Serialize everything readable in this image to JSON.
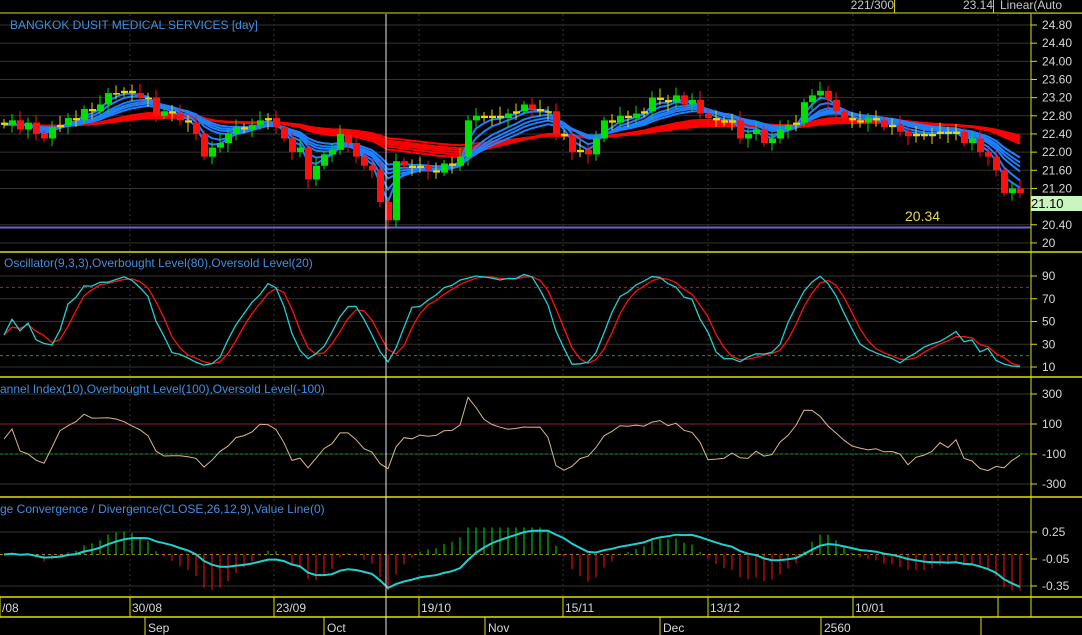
{
  "topbar": {
    "count": "221/300",
    "price": "23.14",
    "scale_mode": "Linear(Auto"
  },
  "price_panel": {
    "title": "BANGKOK DUSIT MEDICAL SERVICES [day]",
    "ticks": [
      "24.80",
      "24.40",
      "24.00",
      "23.60",
      "23.20",
      "22.80",
      "22.40",
      "22.00",
      "21.60",
      "21.20",
      "20.40",
      "20"
    ],
    "last_price_label": "21.10",
    "hline_value": 20.34,
    "hline_label": "20.34"
  },
  "stoch_panel": {
    "title": "Oscillator(9,3,3),Overbought Level(80),Oversold Level(20)",
    "ticks": [
      "90",
      "70",
      "50",
      "30",
      "10"
    ],
    "overbought": 80,
    "oversold": 20
  },
  "cci_panel": {
    "title": "annel Index(10),Overbought Level(100),Oversold Level(-100)",
    "ticks": [
      "300",
      "100",
      "-100",
      "-300"
    ],
    "overbought": 100,
    "oversold": -100
  },
  "macd_panel": {
    "title": "ge Convergence / Divergence(CLOSE,26,12,9),Value Line(0)",
    "ticks": [
      "0.25",
      "-0.05",
      "-0.35"
    ],
    "value_line": 0
  },
  "date_axis": {
    "labels": [
      "/08",
      "30/08",
      "23/09",
      "19/10",
      "15/11",
      "13/12",
      "10/01"
    ]
  },
  "month_axis": {
    "labels": [
      "Sep",
      "Oct",
      "Nov",
      "Dec",
      "2560"
    ]
  },
  "colors": {
    "up": "#00e000",
    "down": "#ff1010",
    "doji": "#e8d800",
    "ma_short": "#1e7fff",
    "ma_long": "#ff0000",
    "k_line": "#20d0d0",
    "d_line": "#ff1010",
    "cci_line": "#d8b888",
    "axis": "#e0e000"
  },
  "chart_data": {
    "type": "candlestick",
    "title": "BANGKOK DUSIT MEDICAL SERVICES [day]",
    "ylim": [
      20,
      24.8
    ],
    "close": [
      22.6,
      22.7,
      22.5,
      22.65,
      22.4,
      22.3,
      22.55,
      22.6,
      22.75,
      22.7,
      22.95,
      22.9,
      23.05,
      23.3,
      23.3,
      23.35,
      23.3,
      23.2,
      23.2,
      22.8,
      22.9,
      22.85,
      22.7,
      22.65,
      22.4,
      21.9,
      22.1,
      22.2,
      22.4,
      22.55,
      22.5,
      22.6,
      22.7,
      22.75,
      22.55,
      22.3,
      22.0,
      22.1,
      21.4,
      21.7,
      21.95,
      22.05,
      22.4,
      22.2,
      21.9,
      21.7,
      21.6,
      20.9,
      20.5,
      21.8,
      21.7,
      21.65,
      21.7,
      21.6,
      21.55,
      21.75,
      21.7,
      21.9,
      22.7,
      22.8,
      22.75,
      22.8,
      22.75,
      22.85,
      22.9,
      23.05,
      22.95,
      22.9,
      22.9,
      22.4,
      22.35,
      22.0,
      22.05,
      21.95,
      22.3,
      22.7,
      22.65,
      22.8,
      22.75,
      22.85,
      22.9,
      23.2,
      23.15,
      23.1,
      23.25,
      23.05,
      23.15,
      22.85,
      22.75,
      22.7,
      22.65,
      22.7,
      22.3,
      22.4,
      22.5,
      22.2,
      22.3,
      22.5,
      22.6,
      22.65,
      23.1,
      23.25,
      23.35,
      23.15,
      22.9,
      22.75,
      22.7,
      22.65,
      22.75,
      22.7,
      22.55,
      22.6,
      22.45,
      22.35,
      22.4,
      22.35,
      22.4,
      22.45,
      22.4,
      22.45,
      22.2,
      22.3,
      22.0,
      21.9,
      21.6,
      21.1,
      21.2,
      21.1
    ]
  }
}
